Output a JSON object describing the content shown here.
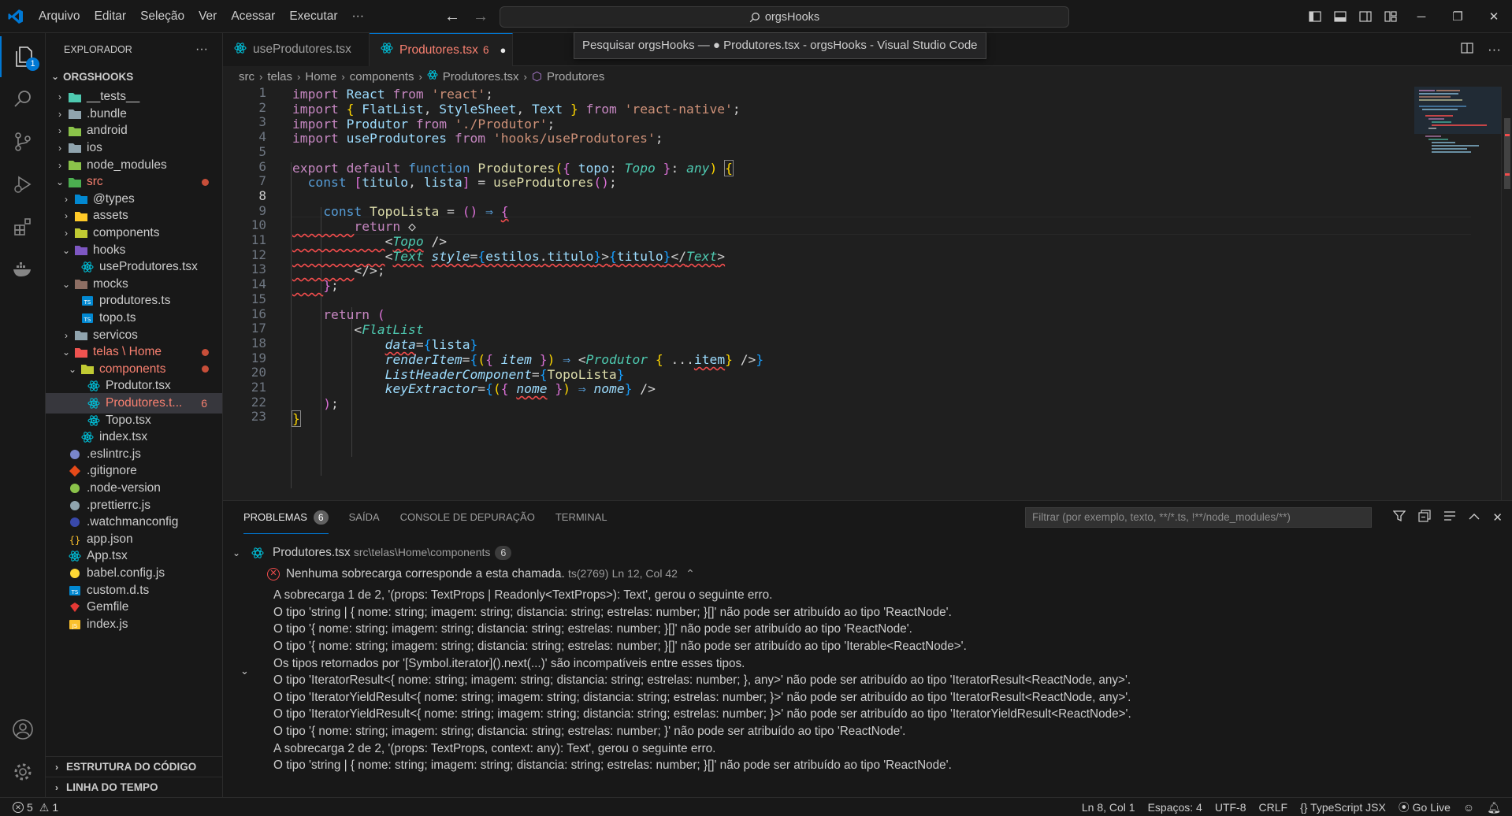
{
  "menu": [
    "Arquivo",
    "Editar",
    "Seleção",
    "Ver",
    "Acessar",
    "Executar",
    "···"
  ],
  "search": {
    "text": "orgsHooks"
  },
  "tooltip": "Pesquisar orgsHooks — ● Produtores.tsx - orgsHooks - Visual Studio Code",
  "activity": {
    "explorer_badge": "1"
  },
  "sidebar": {
    "title": "EXPLORADOR",
    "more": "···",
    "root": "ORGSHOOKS",
    "items": [
      {
        "label": "__tests__",
        "indent": 0,
        "chev": "›",
        "icon": "folder-tests-icon",
        "color": "#4ec9b0"
      },
      {
        "label": ".bundle",
        "indent": 0,
        "chev": "›",
        "icon": "folder-icon",
        "color": "#90a4ae"
      },
      {
        "label": "android",
        "indent": 0,
        "chev": "›",
        "icon": "folder-android-icon",
        "color": "#8bc34a"
      },
      {
        "label": "ios",
        "indent": 0,
        "chev": "›",
        "icon": "folder-ios-icon",
        "color": "#90a4ae"
      },
      {
        "label": "node_modules",
        "indent": 0,
        "chev": "›",
        "icon": "folder-node-icon",
        "color": "#8bc34a"
      },
      {
        "label": "src",
        "indent": 0,
        "chev": "⌄",
        "icon": "folder-src-icon",
        "color": "#4caf50",
        "error": true,
        "dot": true
      },
      {
        "label": "@types",
        "indent": 1,
        "chev": "›",
        "icon": "folder-types-icon",
        "color": "#0288d1"
      },
      {
        "label": "assets",
        "indent": 1,
        "chev": "›",
        "icon": "folder-assets-icon",
        "color": "#ffca28"
      },
      {
        "label": "components",
        "indent": 1,
        "chev": "›",
        "icon": "folder-components-icon",
        "color": "#c0ca33"
      },
      {
        "label": "hooks",
        "indent": 1,
        "chev": "⌄",
        "icon": "folder-hooks-icon",
        "color": "#7e57c2"
      },
      {
        "label": "useProdutores.tsx",
        "indent": 2,
        "chev": "",
        "icon": "react-icon",
        "color": "#00bcd4"
      },
      {
        "label": "mocks",
        "indent": 1,
        "chev": "⌄",
        "icon": "folder-mocks-icon",
        "color": "#8d6e63"
      },
      {
        "label": "produtores.ts",
        "indent": 2,
        "chev": "",
        "icon": "typescript-icon",
        "color": "#0288d1"
      },
      {
        "label": "topo.ts",
        "indent": 2,
        "chev": "",
        "icon": "typescript-icon",
        "color": "#0288d1"
      },
      {
        "label": "servicos",
        "indent": 1,
        "chev": "›",
        "icon": "folder-icon",
        "color": "#90a4ae"
      },
      {
        "label": "telas \\ Home",
        "indent": 1,
        "chev": "⌄",
        "icon": "folder-telas-icon",
        "color": "#ef5350",
        "error": true,
        "dot": true
      },
      {
        "label": "components",
        "indent": 2,
        "chev": "⌄",
        "icon": "folder-components-icon",
        "color": "#c0ca33",
        "error": true,
        "dot": true
      },
      {
        "label": "Produtor.tsx",
        "indent": 3,
        "chev": "",
        "icon": "react-icon",
        "color": "#00bcd4"
      },
      {
        "label": "Produtores.t...",
        "indent": 3,
        "chev": "",
        "icon": "react-icon",
        "color": "#00bcd4",
        "error": true,
        "count": "6",
        "selected": true
      },
      {
        "label": "Topo.tsx",
        "indent": 3,
        "chev": "",
        "icon": "react-icon",
        "color": "#00bcd4"
      },
      {
        "label": "index.tsx",
        "indent": 2,
        "chev": "",
        "icon": "react-icon",
        "color": "#00bcd4"
      },
      {
        "label": ".eslintrc.js",
        "indent": 0,
        "chev": "",
        "icon": "eslint-icon",
        "color": "#7986cb"
      },
      {
        "label": ".gitignore",
        "indent": 0,
        "chev": "",
        "icon": "git-icon",
        "color": "#e64a19"
      },
      {
        "label": ".node-version",
        "indent": 0,
        "chev": "",
        "icon": "nodejs-icon",
        "color": "#8bc34a"
      },
      {
        "label": ".prettierrc.js",
        "indent": 0,
        "chev": "",
        "icon": "prettier-icon",
        "color": "#90a4ae"
      },
      {
        "label": ".watchmanconfig",
        "indent": 0,
        "chev": "",
        "icon": "watchman-icon",
        "color": "#3949ab"
      },
      {
        "label": "app.json",
        "indent": 0,
        "chev": "",
        "icon": "json-icon",
        "color": "#fbc02d"
      },
      {
        "label": "App.tsx",
        "indent": 0,
        "chev": "",
        "icon": "react-icon",
        "color": "#00bcd4"
      },
      {
        "label": "babel.config.js",
        "indent": 0,
        "chev": "",
        "icon": "babel-icon",
        "color": "#fdd835"
      },
      {
        "label": "custom.d.ts",
        "indent": 0,
        "chev": "",
        "icon": "typescript-def-icon",
        "color": "#0288d1"
      },
      {
        "label": "Gemfile",
        "indent": 0,
        "chev": "",
        "icon": "ruby-icon",
        "color": "#e53935"
      },
      {
        "label": "index.js",
        "indent": 0,
        "chev": "",
        "icon": "javascript-icon",
        "color": "#fbc02d"
      }
    ],
    "sections": [
      "ESTRUTURA DO CÓDIGO",
      "LINHA DO TEMPO"
    ]
  },
  "tabs": [
    {
      "label": "useProdutores.tsx",
      "active": false
    },
    {
      "label": "Produtores.tsx",
      "count": "6",
      "active": true,
      "modified": "●"
    }
  ],
  "breadcrumb": [
    "src",
    "telas",
    "Home",
    "components",
    "Produtores.tsx",
    "Produtores"
  ],
  "editor": {
    "line_numbers": [
      "1",
      "2",
      "3",
      "4",
      "5",
      "6",
      "7",
      "8",
      "9",
      "10",
      "11",
      "12",
      "13",
      "14",
      "15",
      "16",
      "17",
      "18",
      "19",
      "20",
      "21",
      "22",
      "23"
    ],
    "current_line": "8"
  },
  "panel": {
    "tabs": [
      "PROBLEMAS",
      "SAÍDA",
      "CONSOLE DE DEPURAÇÃO",
      "TERMINAL"
    ],
    "problems_count": "6",
    "filter_placeholder": "Filtrar (por exemplo, texto, **/*.ts, !**/node_modules/**)",
    "file": {
      "name": "Produtores.tsx",
      "path": "src\\telas\\Home\\components",
      "count": "6"
    },
    "error": {
      "message": "Nenhuma sobrecarga corresponde a esta chamada.",
      "code": "ts(2769)",
      "location": "Ln 12, Col 42"
    },
    "details": [
      "A sobrecarga 1 de 2, '(props: TextProps | Readonly<TextProps>): Text', gerou o seguinte erro.",
      "O tipo 'string | { nome: string; imagem: string; distancia: string; estrelas: number; }[]' não pode ser atribuído ao tipo 'ReactNode'.",
      "O tipo '{ nome: string; imagem: string; distancia: string; estrelas: number; }[]' não pode ser atribuído ao tipo 'ReactNode'.",
      "O tipo '{ nome: string; imagem: string; distancia: string; estrelas: number; }[]' não pode ser atribuído ao tipo 'Iterable<ReactNode>'.",
      "Os tipos retornados por '[Symbol.iterator]().next(...)' são incompatíveis entre esses tipos.",
      "O tipo 'IteratorResult<{ nome: string; imagem: string; distancia: string; estrelas: number; }, any>' não pode ser atribuído ao tipo 'IteratorResult<ReactNode, any>'.",
      "O tipo 'IteratorYieldResult<{ nome: string; imagem: string; distancia: string; estrelas: number; }>' não pode ser atribuído ao tipo 'IteratorResult<ReactNode, any>'.",
      "O tipo 'IteratorYieldResult<{ nome: string; imagem: string; distancia: string; estrelas: number; }>' não pode ser atribuído ao tipo 'IteratorYieldResult<ReactNode>'.",
      "O tipo '{ nome: string; imagem: string; distancia: string; estrelas: number; }' não pode ser atribuído ao tipo 'ReactNode'.",
      "A sobrecarga 2 de 2, '(props: TextProps, context: any): Text', gerou o seguinte erro.",
      "O tipo 'string | { nome: string; imagem: string; distancia: string; estrelas: number; }[]' não pode ser atribuído ao tipo 'ReactNode'."
    ]
  },
  "status": {
    "errors": "5",
    "warnings": "1",
    "position": "Ln 8, Col 1",
    "spaces": "Espaços: 4",
    "encoding": "UTF-8",
    "eol": "CRLF",
    "language": "TypeScript JSX",
    "golive": "Go Live"
  }
}
